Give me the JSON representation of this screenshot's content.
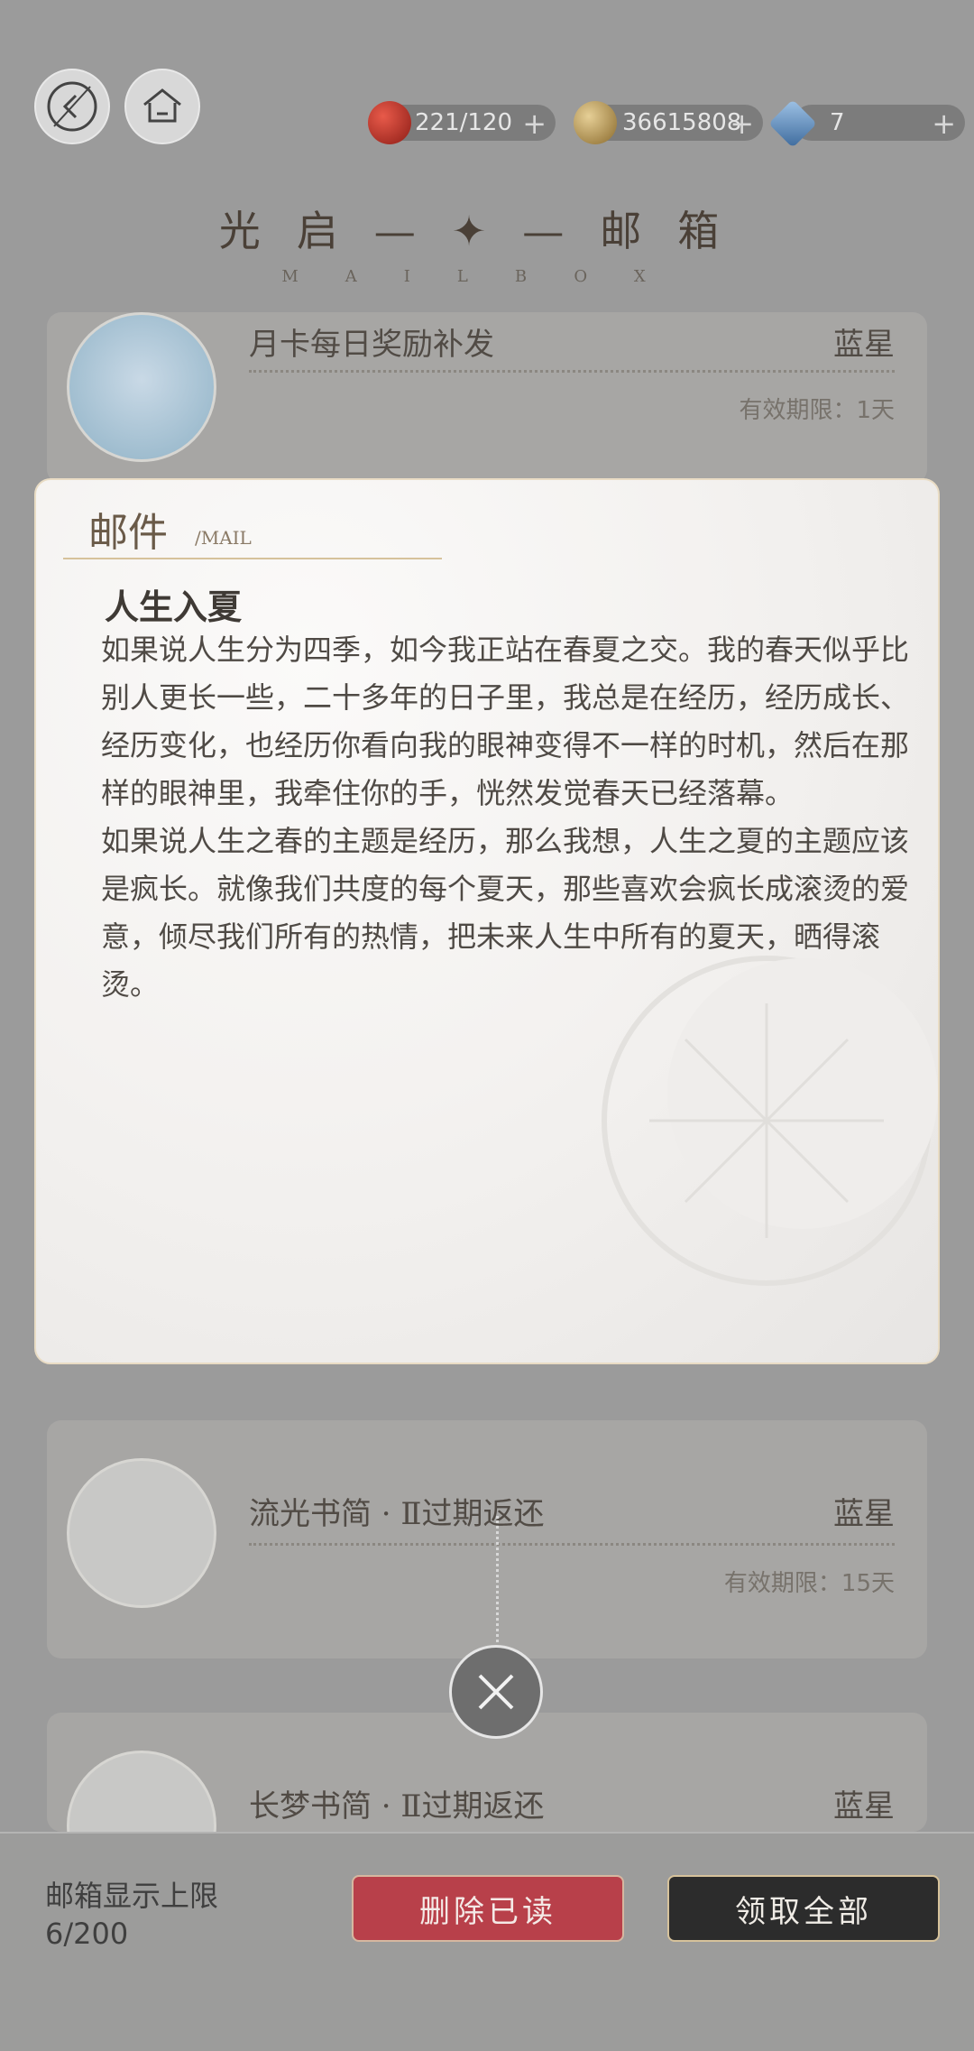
{
  "header": {
    "stamina": "221/120",
    "coins": "36615808",
    "gems": "7",
    "plus": "+",
    "title": "光启—✦—邮箱",
    "subtitle": "MAILBOX"
  },
  "list": [
    {
      "name": "月卡每日奖励补发",
      "sender": "蓝星",
      "expire": "有效期限：1天"
    },
    {
      "name": "流光书简 · Ⅱ过期返还",
      "sender": "蓝星",
      "expire": "有效期限：15天"
    },
    {
      "name": "长梦书简 · Ⅱ过期返还",
      "sender": "蓝星",
      "expire": ""
    }
  ],
  "modal": {
    "label": "邮件",
    "label_sub": "/MAIL",
    "title": "人生入夏",
    "paragraph1": "如果说人生分为四季，如今我正站在春夏之交。我的春天似乎比别人更长一些，二十多年的日子里，我总是在经历，经历成长、经历变化，也经历你看向我的眼神变得不一样的时机，然后在那样的眼神里，我牵住你的手，恍然发觉春天已经落幕。",
    "paragraph2": "如果说人生之春的主题是经历，那么我想，人生之夏的主题应该是疯长。就像我们共度的每个夏天，那些喜欢会疯长成滚烫的爱意，倾尽我们所有的热情，把未来人生中所有的夏天，晒得滚烫。"
  },
  "footer": {
    "limit_label": "邮箱显示上限",
    "limit_count": "6/200",
    "delete_read": "删除已读",
    "claim_all": "领取全部"
  },
  "colors": {
    "delete_button": "#b8404a",
    "claim_button": "#2c2c2c",
    "accent_gold": "#d6c29b"
  }
}
